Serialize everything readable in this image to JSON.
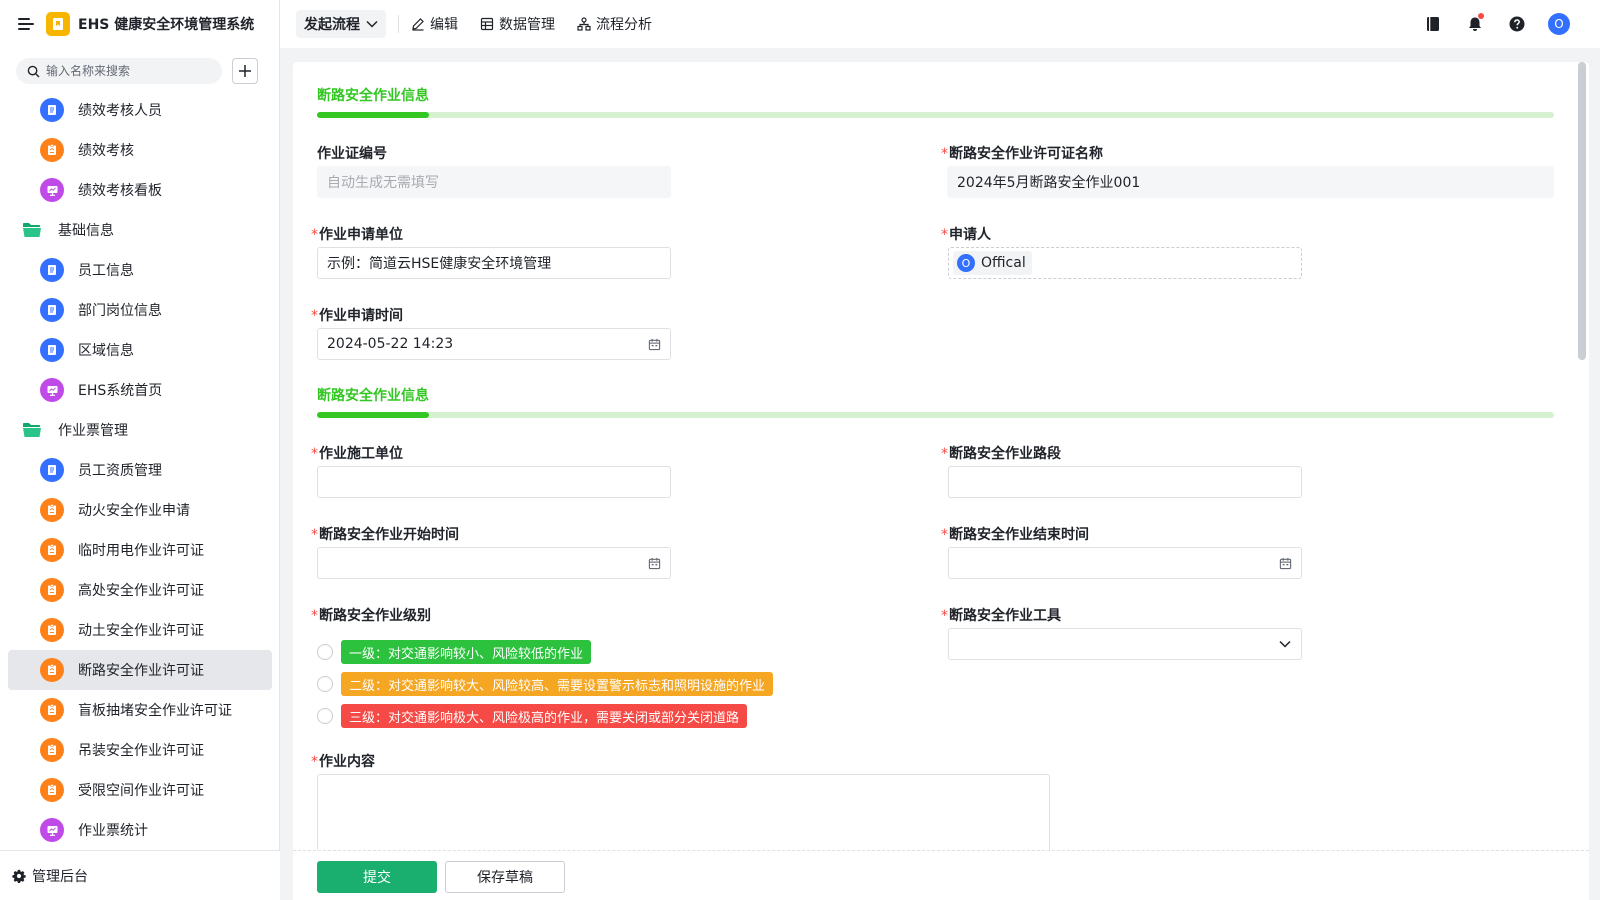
{
  "app": {
    "title": "EHS 健康安全环境管理系统"
  },
  "sidebar": {
    "search_placeholder": "输入名称来搜索",
    "items": [
      {
        "label": "绩效考核人员",
        "icon": "form-icon",
        "color": "blue",
        "type": "form"
      },
      {
        "label": "绩效考核",
        "icon": "workflow-icon",
        "color": "orange",
        "type": "form"
      },
      {
        "label": "绩效考核看板",
        "icon": "dashboard-icon",
        "color": "purple",
        "type": "form"
      },
      {
        "label": "基础信息",
        "icon": "folder-icon",
        "type": "folder"
      },
      {
        "label": "员工信息",
        "icon": "form-icon",
        "color": "blue",
        "type": "form"
      },
      {
        "label": "部门岗位信息",
        "icon": "form-icon",
        "color": "blue",
        "type": "form"
      },
      {
        "label": "区域信息",
        "icon": "form-icon",
        "color": "blue",
        "type": "form"
      },
      {
        "label": "EHS系统首页",
        "icon": "dashboard-icon",
        "color": "purple",
        "type": "form"
      },
      {
        "label": "作业票管理",
        "icon": "folder-icon",
        "type": "folder"
      },
      {
        "label": "员工资质管理",
        "icon": "form-icon",
        "color": "blue",
        "type": "form"
      },
      {
        "label": "动火安全作业申请",
        "icon": "workflow-icon",
        "color": "orange",
        "type": "form"
      },
      {
        "label": "临时用电作业许可证",
        "icon": "workflow-icon",
        "color": "orange",
        "type": "form"
      },
      {
        "label": "高处安全作业许可证",
        "icon": "workflow-icon",
        "color": "orange",
        "type": "form"
      },
      {
        "label": "动土安全作业许可证",
        "icon": "workflow-icon",
        "color": "orange",
        "type": "form"
      },
      {
        "label": "断路安全作业许可证",
        "icon": "workflow-icon",
        "color": "orange",
        "type": "form",
        "active": true
      },
      {
        "label": "盲板抽堵安全作业许可证",
        "icon": "workflow-icon",
        "color": "orange",
        "type": "form"
      },
      {
        "label": "吊装安全作业许可证",
        "icon": "workflow-icon",
        "color": "orange",
        "type": "form"
      },
      {
        "label": "受限空间作业许可证",
        "icon": "workflow-icon",
        "color": "orange",
        "type": "form"
      },
      {
        "label": "作业票统计",
        "icon": "dashboard-icon",
        "color": "purple",
        "type": "form"
      }
    ],
    "admin_label": "管理后台"
  },
  "topbar": {
    "launch_label": "发起流程",
    "edit_label": "编辑",
    "data_label": "数据管理",
    "flow_label": "流程分析",
    "avatar_letter": "O"
  },
  "form": {
    "section1_title": "断路安全作业信息",
    "section2_title": "断路安全作业信息",
    "cert_no_label": "作业证编号",
    "cert_no_placeholder": "自动生成无需填写",
    "permit_name_label": "断路安全作业许可证名称",
    "permit_name_value": "2024年5月断路安全作业001",
    "apply_unit_label": "作业申请单位",
    "apply_unit_value": "示例：简道云HSE健康安全环境管理",
    "applicant_label": "申请人",
    "applicant_initial": "O",
    "applicant_name": "Offical",
    "apply_time_label": "作业申请时间",
    "apply_time_value": "2024-05-22 14:23",
    "construct_unit_label": "作业施工单位",
    "road_section_label": "断路安全作业路段",
    "start_time_label": "断路安全作业开始时间",
    "end_time_label": "断路安全作业结束时间",
    "level_label": "断路安全作业级别",
    "level_options": [
      {
        "label": "一级：对交通影响较小、风险较低的作业",
        "color": "#2cc23e"
      },
      {
        "label": "二级：对交通影响较大、风险较高、需要设置警示标志和照明设施的作业",
        "color": "#f5a623"
      },
      {
        "label": "三级：对交通影响极大、风险极高的作业，需要关闭或部分关闭道路",
        "color": "#f54a45"
      }
    ],
    "tool_label": "断路安全作业工具",
    "content_label": "作业内容",
    "required_mark": "*"
  },
  "footer": {
    "submit_label": "提交",
    "draft_label": "保存草稿"
  },
  "colors": {
    "accent_green": "#34c724",
    "submit_green": "#1aae6f",
    "brand_yellow": "#f7b500",
    "blue": "#3370ff",
    "orange": "#ff811a",
    "purple": "#c04ae8"
  }
}
